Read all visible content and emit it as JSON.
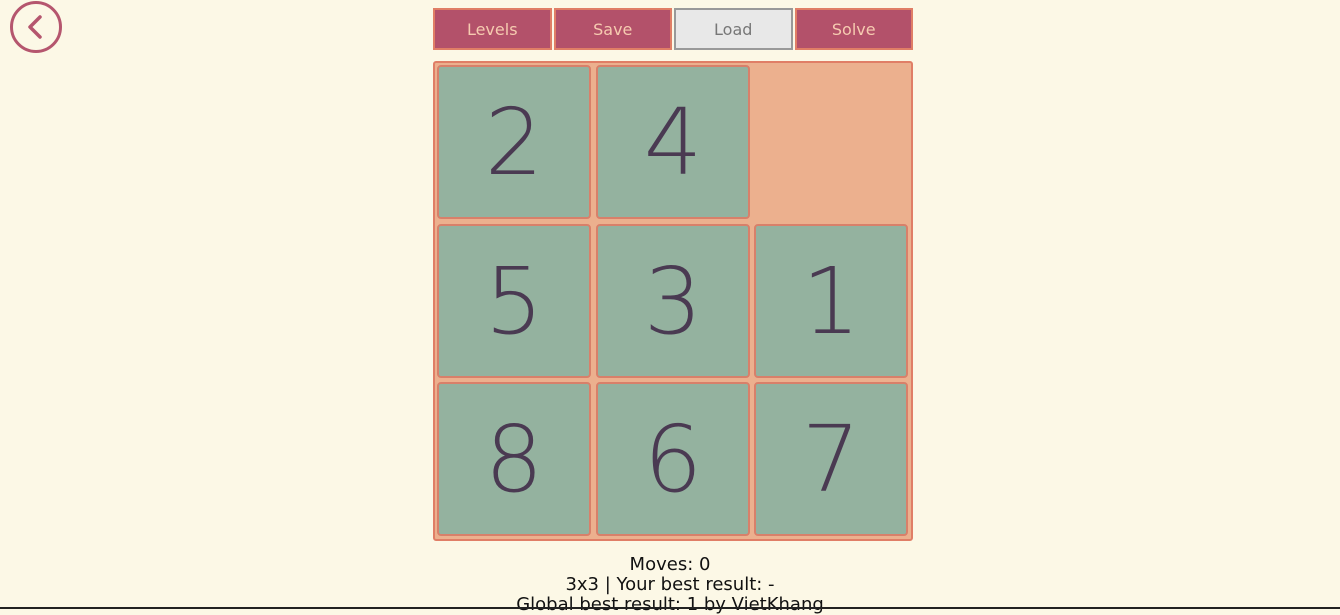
{
  "toolbar": {
    "levels_label": "Levels",
    "save_label": "Save",
    "load_label": "Load",
    "solve_label": "Solve"
  },
  "board": {
    "size": "3x3",
    "tiles": [
      "2",
      "4",
      "",
      "5",
      "3",
      "1",
      "8",
      "6",
      "7"
    ]
  },
  "stats": {
    "moves": "Moves: 0",
    "best": "3x3 | Your best result: -",
    "global": "Global best result: 1 by VietKhang"
  },
  "colors": {
    "background": "#fcf8e6",
    "button": "#b3516a",
    "tile": "#94b29f",
    "board": "#ecb08e"
  },
  "icons": {
    "back": "chevron-left-icon"
  }
}
